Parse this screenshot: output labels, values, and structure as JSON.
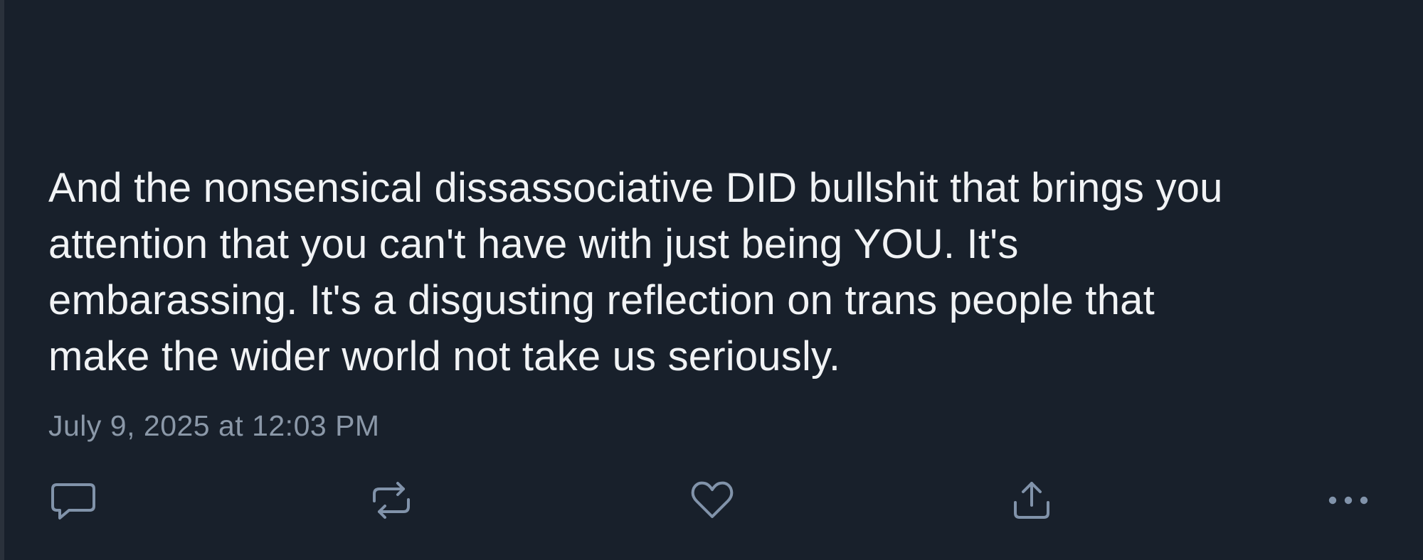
{
  "post": {
    "text": "And the nonsensical dissassociative DID bullshit that brings you\nattention that you can't have with just being YOU. It's\nembarassing. It's a disgusting reflection on trans people that\nmake the wider world not take us seriously.",
    "timestamp": "July 9, 2025 at 12:03 PM"
  },
  "actions": [
    {
      "name": "reply",
      "icon": "speech-bubble-icon"
    },
    {
      "name": "repost",
      "icon": "repost-arrows-icon"
    },
    {
      "name": "like",
      "icon": "heart-icon"
    },
    {
      "name": "share",
      "icon": "share-upload-icon"
    },
    {
      "name": "more",
      "icon": "more-dots-icon"
    }
  ],
  "colors": {
    "background": "#18202b",
    "text": "#f1f3f5",
    "muted_text": "#8b98a8",
    "icon": "#8193aa"
  }
}
